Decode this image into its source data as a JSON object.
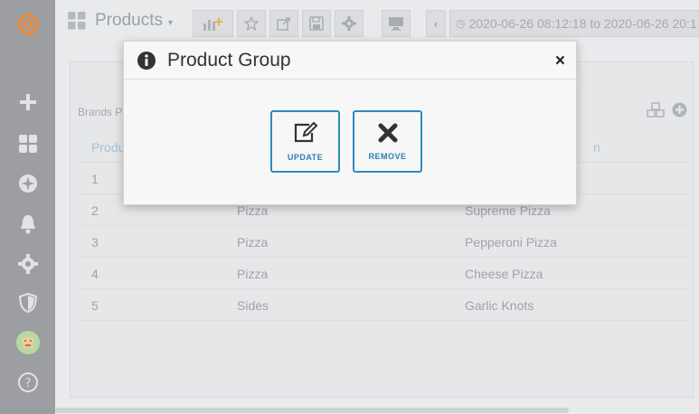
{
  "header": {
    "title": "Products",
    "time_range": "2020-06-26 08:12:18 to 2020-06-26 20:1"
  },
  "panel": {
    "title": "Brands Pr",
    "columns": [
      "Produ",
      "",
      "n"
    ],
    "rows": [
      {
        "id": "1",
        "group": "",
        "name": ""
      },
      {
        "id": "2",
        "group": "Pizza",
        "name": "Supreme Pizza"
      },
      {
        "id": "3",
        "group": "Pizza",
        "name": "Pepperoni Pizza"
      },
      {
        "id": "4",
        "group": "Pizza",
        "name": "Cheese Pizza"
      },
      {
        "id": "5",
        "group": "Sides",
        "name": "Garlic Knots"
      }
    ]
  },
  "modal": {
    "title": "Product Group",
    "update_label": "UPDATE",
    "remove_label": "REMOVE"
  },
  "colors": {
    "accent": "#2c8dba",
    "sidebar": "#9c9ea2",
    "brand": "#f28b33"
  }
}
